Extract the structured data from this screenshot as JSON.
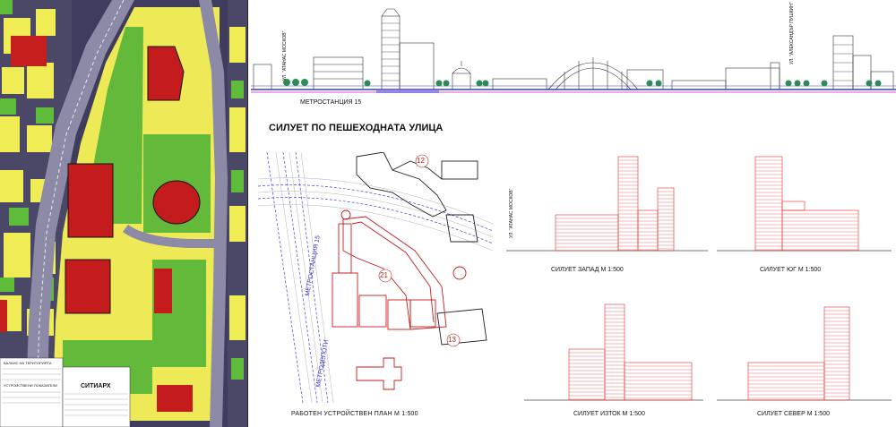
{
  "sheet": {
    "top_street_title": "СИЛУЕТ ПО ПЕШЕХОДНАТА УЛИЦА",
    "metro_station_label": "МЕТРОСТАНЦИЯ 15",
    "street_tags": [
      "УЛ. \"АТАНАС МОСКОВ\"",
      "УЛ. \"АЛЕКСАНДЪР ПУШКИН\""
    ],
    "plan_caption": "РАБОТЕН УСТРОЙСТВЕН ПЛАН  М 1:500",
    "plan_metro_label_1": "МЕТРОСТАНЦИЯ 15",
    "plan_metro_label_2": "МЕТРОДЕПОТИ",
    "plan_parcel_numbers": [
      "12",
      "21",
      "13"
    ],
    "elevation_street_tag": "УЛ. \"АТАНАС МОСКОВ\"",
    "elevations": [
      {
        "caption": "СИЛУЕТ ЗАПАД  М 1:500"
      },
      {
        "caption": "СИЛУЕТ ЮГ  М 1:500"
      },
      {
        "caption": "СИЛУЕТ ИЗТОК  М 1:500"
      },
      {
        "caption": "СИЛУЕТ СЕВЕР  М 1:500"
      }
    ],
    "map_company": "СИТИАРХ",
    "map_legend_title": "БАЛАНС НА ТЕРИТОРИЯТА",
    "map_indicators_title": "УСТРОЙСТВЕНИ ПОКАЗАТЕЛИ"
  },
  "colors": {
    "map_base": "#3d3a5c",
    "zone_yellow": "#f2ef5a",
    "zone_green": "#6cbf3a",
    "zone_red": "#d11f1f",
    "road": "#8a8aa8",
    "elevation_red": "#e33030",
    "street_blue": "#4040d0",
    "street_magenta": "#c020c0"
  }
}
